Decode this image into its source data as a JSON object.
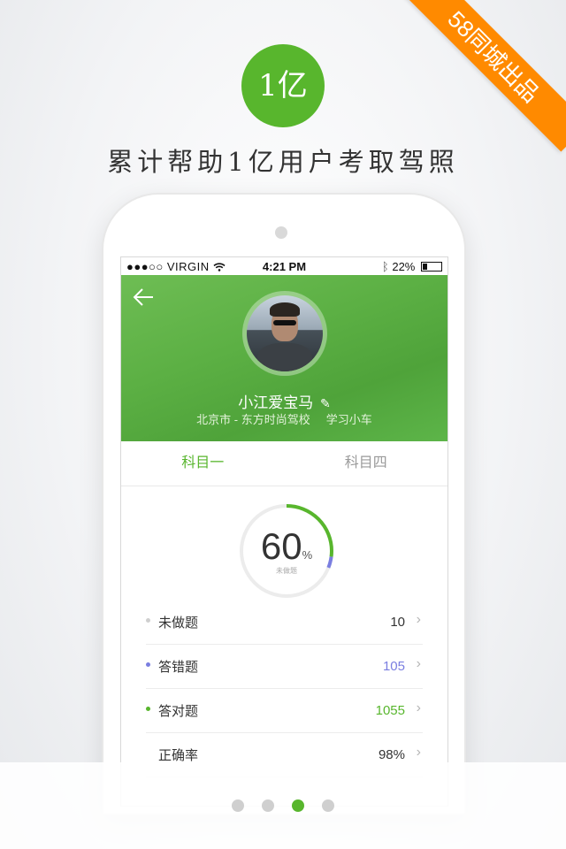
{
  "brand_ribbon": "58同城出品",
  "badge_text": "1亿",
  "headline": "累计帮助1亿用户考取驾照",
  "status_bar": {
    "carrier": "●●●○○ VIRGIN",
    "time": "4:21 PM",
    "battery": "22%"
  },
  "profile": {
    "name": "小江爱宝马",
    "school": "北京市 - 东方时尚驾校",
    "course": "学习小车"
  },
  "tabs": [
    {
      "label": "科目一",
      "active": true
    },
    {
      "label": "科目四",
      "active": false
    }
  ],
  "progress": {
    "value": "60",
    "unit": "%",
    "caption": "未做题",
    "fraction": 0.6
  },
  "stats": [
    {
      "label": "未做题",
      "value": "10",
      "dot_color": "#cfcfcf",
      "value_color": "#333333"
    },
    {
      "label": "答错题",
      "value": "105",
      "dot_color": "#7a7ee0",
      "value_color": "#7a7ee0"
    },
    {
      "label": "答对题",
      "value": "1055",
      "dot_color": "#58b62d",
      "value_color": "#58b62d"
    },
    {
      "label": "正确率",
      "value": "98%",
      "dot_color": "transparent",
      "value_color": "#333333"
    }
  ],
  "pager": {
    "count": 4,
    "active_index": 2
  },
  "colors": {
    "accent": "#58b62d",
    "ribbon": "#ff8a00",
    "wrong": "#7a7ee0"
  },
  "icons": {
    "back": "back-arrow-icon",
    "edit": "pencil-icon",
    "wifi": "wifi-icon",
    "bluetooth": "bluetooth-icon",
    "battery": "battery-icon",
    "chevron": "chevron-right-icon"
  }
}
